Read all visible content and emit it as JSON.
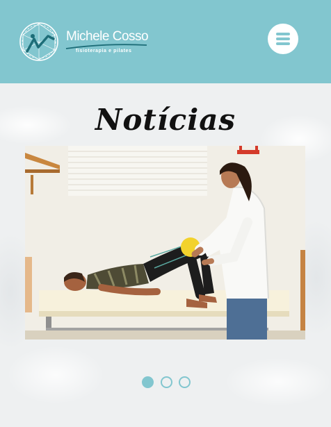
{
  "header": {
    "logo_name": "Michele Cosso",
    "logo_tagline": "fisioterapia e pilates",
    "menu_icon": "hamburger-menu-icon"
  },
  "section": {
    "title": "Notícias"
  },
  "carousel": {
    "slide_count": 3,
    "active_slide": 1,
    "slide_image": "physiotherapist assisting patient lying on table with ball between knees"
  },
  "colors": {
    "brand": "#82c6cf",
    "background": "#eef0f1",
    "title": "#111111"
  }
}
